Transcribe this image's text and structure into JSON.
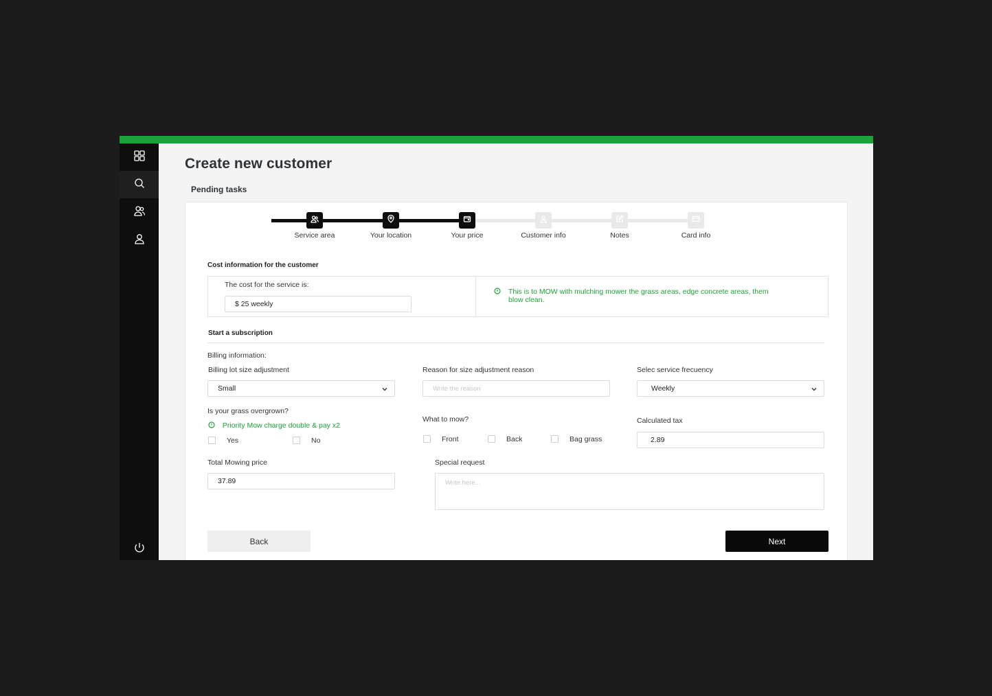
{
  "colors": {
    "accent": "#1aa336",
    "sidebar": "#0e0e0e",
    "primary_button": "#0a0a0a"
  },
  "sidebar": {
    "items": [
      {
        "icon": "grid-icon"
      },
      {
        "icon": "search-icon"
      },
      {
        "icon": "users-icon"
      },
      {
        "icon": "user-icon"
      }
    ],
    "bottom_icon": "power-icon"
  },
  "page": {
    "title": "Create new customer",
    "section": "Pending tasks"
  },
  "stepper": {
    "steps": [
      {
        "label": "Service area",
        "icon": "users-icon",
        "status": "done"
      },
      {
        "label": "Your location",
        "icon": "location-pin-icon",
        "status": "done"
      },
      {
        "label": "Your price",
        "icon": "wallet-icon",
        "status": "current"
      },
      {
        "label": "Customer info",
        "icon": "user-icon",
        "status": "todo"
      },
      {
        "label": "Notes",
        "icon": "edit-icon",
        "status": "todo"
      },
      {
        "label": "Card info",
        "icon": "credit-card-icon",
        "status": "todo"
      }
    ]
  },
  "cost": {
    "heading": "Cost information for the customer",
    "label": "The cost for the service is:",
    "value": "$ 25 weekly",
    "note_line1": "This is to MOW with mulching mower the grass areas, edge concrete areas, them",
    "note_line2": "blow clean."
  },
  "subscription": {
    "heading": "Start a subscription",
    "billing_info": "Billing information:",
    "lot_size": {
      "label": "Billing lot size adjustment",
      "value": "Small"
    },
    "reason": {
      "label": "Reason for size adjustment reason",
      "placeholder": "Write the reason"
    },
    "frequency": {
      "label": "Selec service frecuency",
      "value": "Weekly"
    },
    "overgrown": {
      "label": "Is your grass overgrown?",
      "note": "Priority Mow charge double & pay x2",
      "options": [
        "Yes",
        "No"
      ]
    },
    "what_to_mow": {
      "label": "What to mow?",
      "options": [
        "Front",
        "Back",
        "Bag grass"
      ]
    },
    "tax": {
      "label": "Calculated tax",
      "value": "2.89"
    },
    "total": {
      "label": "Total Mowing price",
      "value": "37.89"
    },
    "special": {
      "label": "Special request",
      "placeholder": "Write here..."
    }
  },
  "buttons": {
    "back": "Back",
    "next": "Next"
  }
}
